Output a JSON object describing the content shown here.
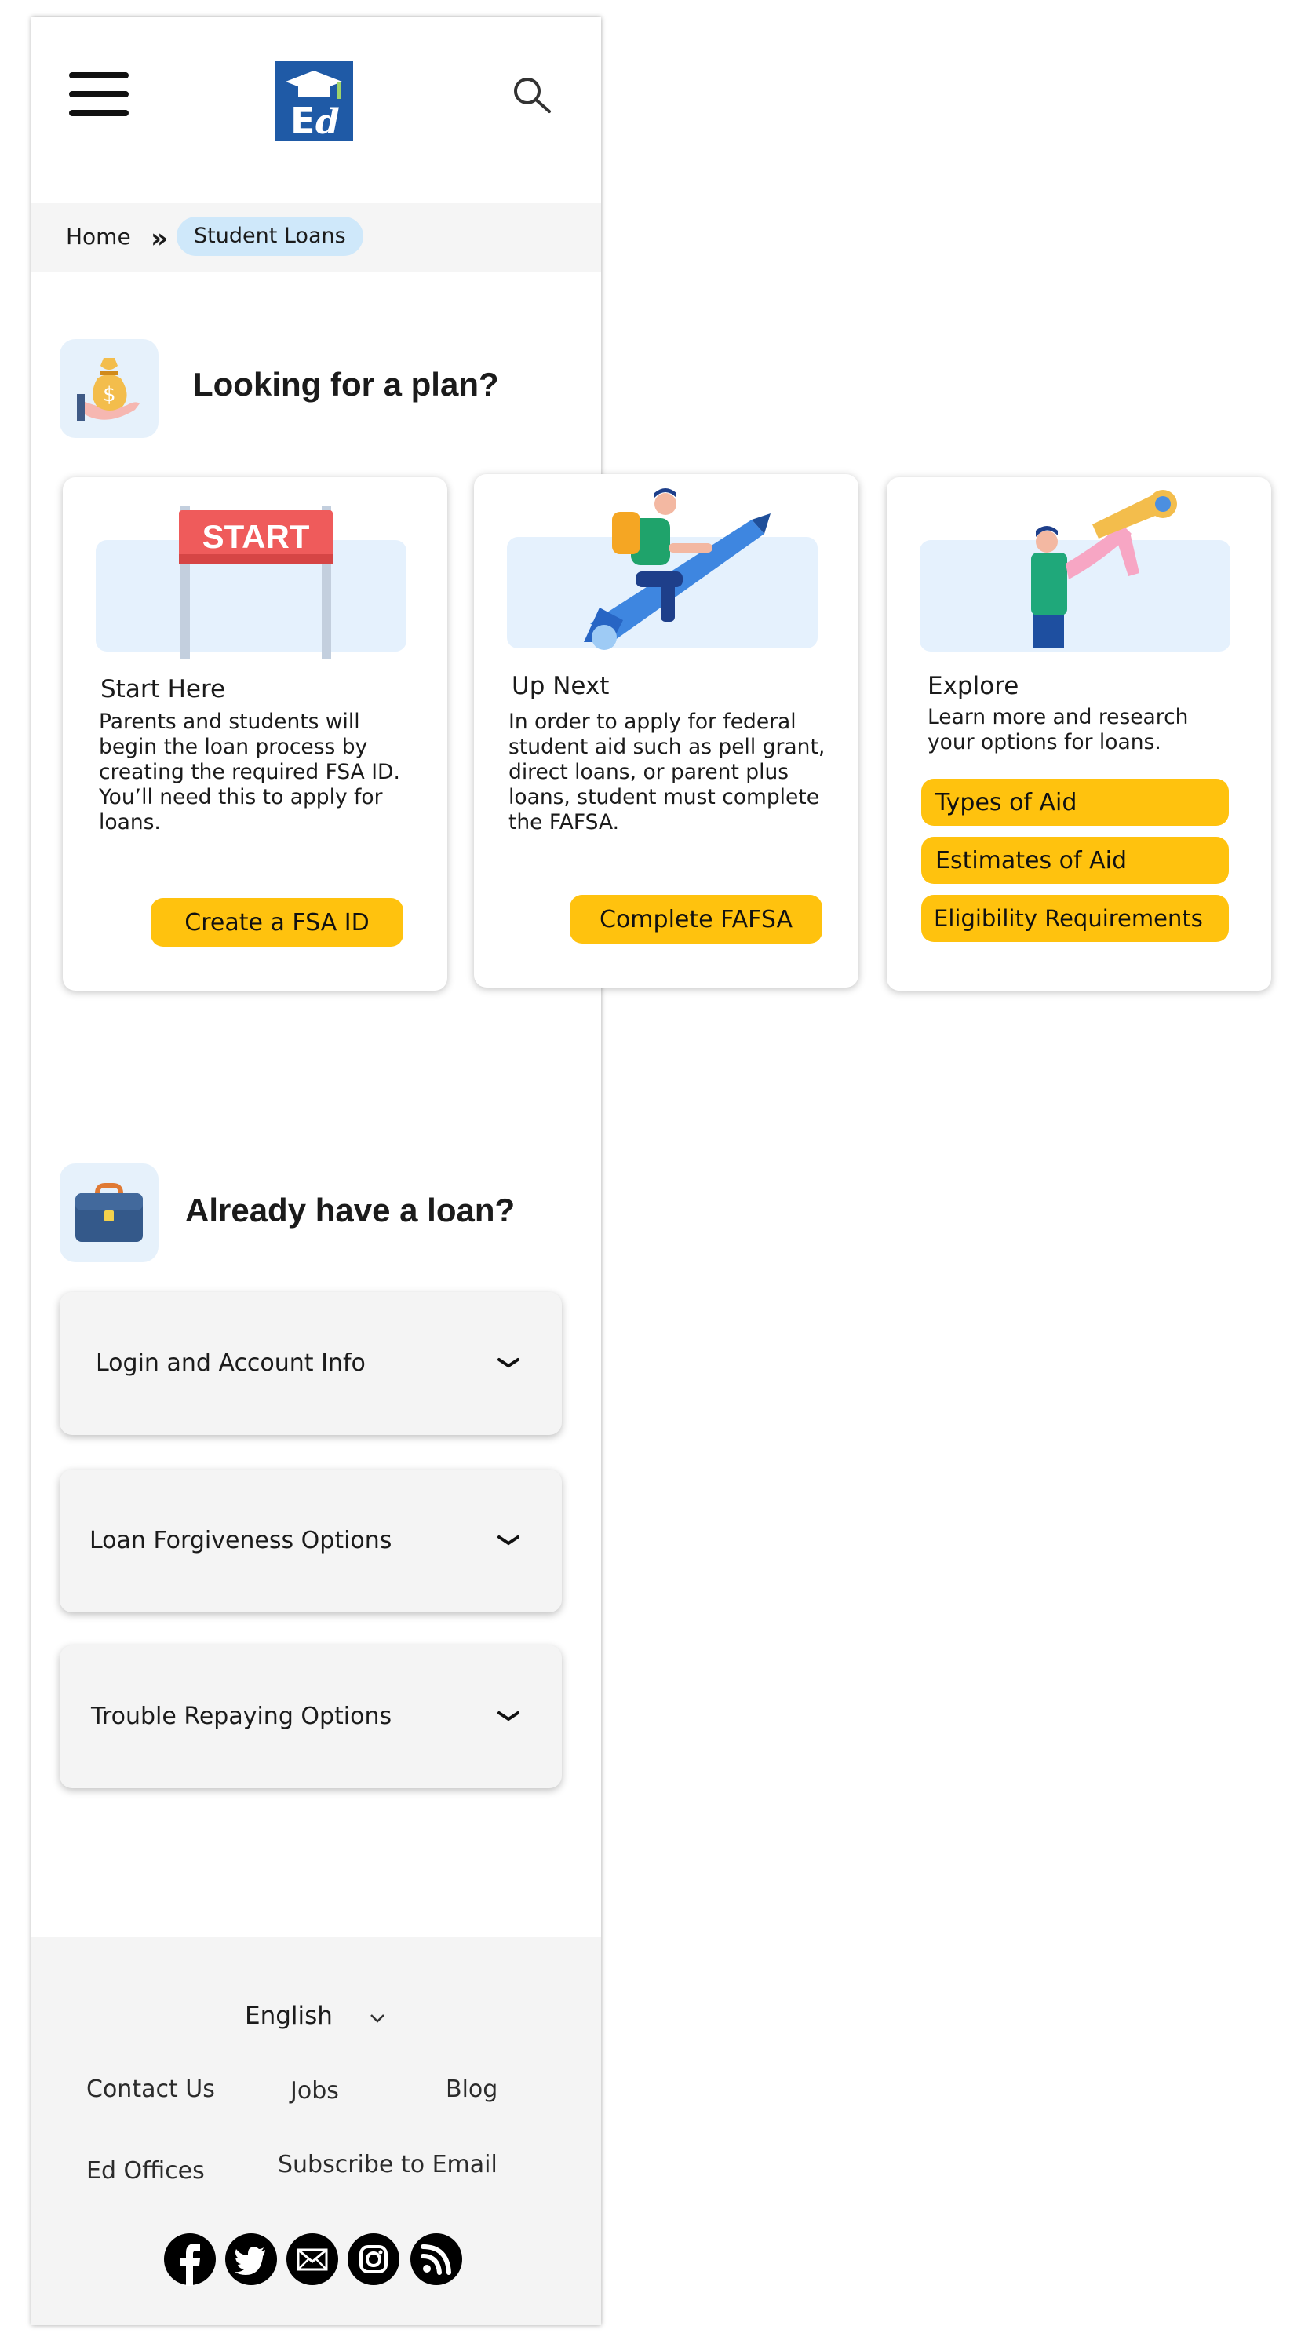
{
  "header": {
    "menu_icon": "hamburger-menu-icon",
    "logo_icon": "ed-logo-icon",
    "search_icon": "search-icon"
  },
  "breadcrumb": {
    "home": "Home",
    "separator": "»",
    "current": "Student Loans"
  },
  "plan_section": {
    "icon": "money-bag-icon",
    "title": "Looking for a plan?",
    "cards": [
      {
        "illustration": "start-banner-illustration",
        "banner_text": "START",
        "title": "Start Here",
        "description": "Parents and students will begin the loan process by creating the required FSA ID. You’ll need this to apply for loans.",
        "buttons": [
          "Create a FSA ID"
        ]
      },
      {
        "illustration": "rocket-pencil-illustration",
        "title": "Up Next",
        "description": "In order to apply for federal student aid such as pell grant, direct loans, or parent plus loans, student must complete the FAFSA.",
        "buttons": [
          "Complete FAFSA"
        ]
      },
      {
        "illustration": "telescope-illustration",
        "title": "Explore",
        "description": "Learn more and research your options for loans.",
        "buttons": [
          "Types of Aid",
          "Estimates of Aid",
          "Eligibility Requirements"
        ]
      }
    ]
  },
  "loan_section": {
    "icon": "briefcase-icon",
    "title": "Already have a loan?",
    "accordions": [
      {
        "label": "Login and Account Info",
        "icon": "chevron-down-icon"
      },
      {
        "label": "Loan Forgiveness Options",
        "icon": "chevron-down-icon"
      },
      {
        "label": "Trouble Repaying Options",
        "icon": "chevron-down-icon"
      }
    ]
  },
  "footer": {
    "language": "English",
    "links": [
      "Contact Us",
      "Jobs",
      "Blog",
      "Ed Offices",
      "Subscribe to Email"
    ],
    "social": [
      "facebook-icon",
      "twitter-icon",
      "email-icon",
      "instagram-icon",
      "rss-icon"
    ]
  },
  "colors": {
    "accent_yellow": "#ffc20e",
    "breadcrumb_pill": "#cfe8fa",
    "illustration_bg": "#e5f1fd",
    "logo_blue": "#1f5aa6"
  }
}
